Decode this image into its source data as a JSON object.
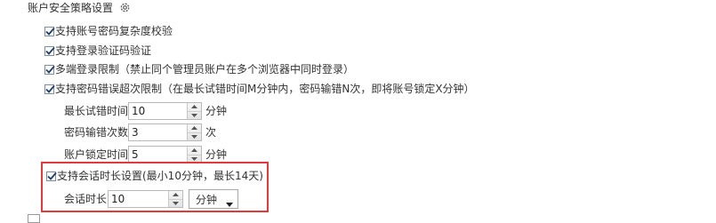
{
  "section": {
    "title": "账户安全策略设置",
    "title_icon": "gear-icon"
  },
  "options": [
    {
      "label": "支持账号密码复杂度校验",
      "checked": true
    },
    {
      "label": "支持登录验证码验证",
      "checked": true
    },
    {
      "label": "多端登录限制（禁止同个管理员账户在多个浏览器中同时登录）",
      "checked": true
    },
    {
      "label": "支持密码错误超次限制（在最长试错时间M分钟内，密码输错N次，即将账号锁定X分钟）",
      "checked": true
    }
  ],
  "retry_settings": {
    "max_retry_time": {
      "label": "最长试错时间",
      "value": "10",
      "unit": "分钟"
    },
    "error_count": {
      "label": "密码输错次数",
      "value": "3",
      "unit": "次"
    },
    "lock_time": {
      "label": "账户锁定时间",
      "value": "5",
      "unit": "分钟"
    }
  },
  "session": {
    "checkbox_label": "支持会话时长设置(最小10分钟，最长14天)",
    "checked": true,
    "duration_label": "会话时长",
    "duration_value": "10",
    "unit_selected": "分钟"
  },
  "colors": {
    "highlight_border": "#e23a3a",
    "check_mark": "#1f3f6b"
  }
}
